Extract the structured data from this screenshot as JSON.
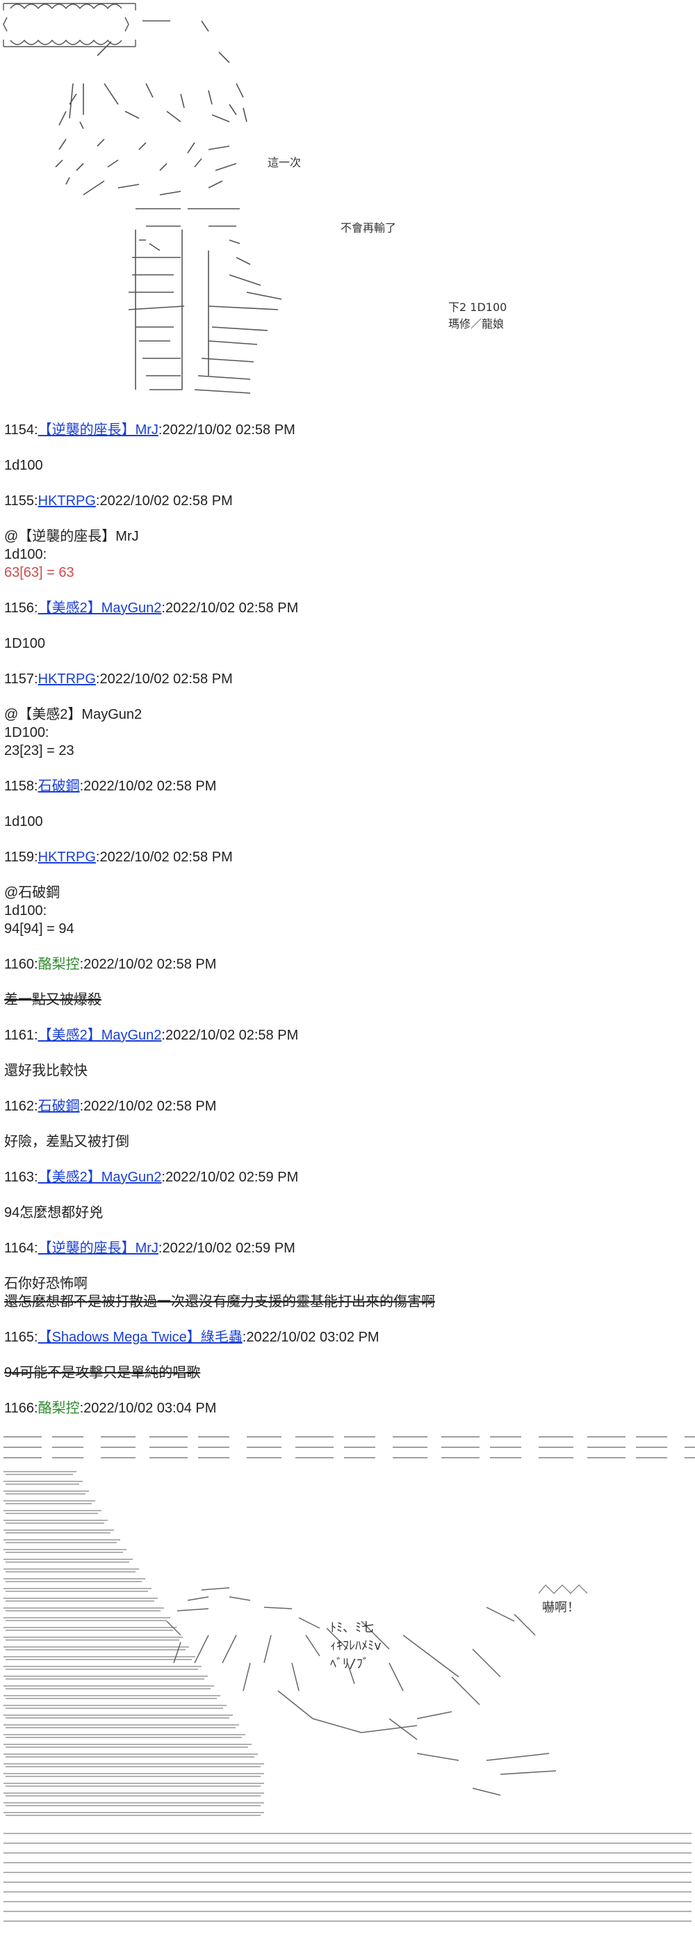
{
  "top_art": {
    "this_time": "這一次",
    "bubble_text": "不會再輸了",
    "roll_box_line1": "下2  1D100",
    "roll_box_line2": "瑪修／龍娘"
  },
  "posts": [
    {
      "num": "1154:",
      "name": "【逆襲的座長】MrJ",
      "name_style": "link",
      "time": ":2022/10/02 02:58 PM",
      "body": [
        "1d100"
      ]
    },
    {
      "num": "1155:",
      "name": "HKTRPG",
      "name_style": "link",
      "time": ":2022/10/02 02:58 PM",
      "body": [
        "@【逆襲的座長】MrJ",
        "1d100:"
      ],
      "result": "63[63] = 63",
      "result_red": true
    },
    {
      "num": "1156:",
      "name": "【美感2】MayGun2",
      "name_style": "link",
      "time": ":2022/10/02 02:58 PM",
      "body": [
        "1D100"
      ]
    },
    {
      "num": "1157:",
      "name": "HKTRPG",
      "name_style": "link",
      "time": ":2022/10/02 02:58 PM",
      "body": [
        "@【美感2】MayGun2",
        "1D100:"
      ],
      "result": "23[23] = 23",
      "result_red": false
    },
    {
      "num": "1158:",
      "name": "石破鋼",
      "name_style": "link",
      "time": ":2022/10/02 02:58 PM",
      "body": [
        "1d100"
      ]
    },
    {
      "num": "1159:",
      "name": "HKTRPG",
      "name_style": "link",
      "time": ":2022/10/02 02:58 PM",
      "body": [
        "@石破鋼",
        "1d100:"
      ],
      "result": "94[94] = 94",
      "result_red": false
    },
    {
      "num": "1160:",
      "name": "酪梨控",
      "name_style": "green",
      "time": ":2022/10/02 02:58 PM",
      "body_strike": "差一點又被爆殺"
    },
    {
      "num": "1161:",
      "name": "【美感2】MayGun2",
      "name_style": "link",
      "time": ":2022/10/02 02:58 PM",
      "body": [
        "還好我比較快"
      ]
    },
    {
      "num": "1162:",
      "name": "石破鋼",
      "name_style": "link",
      "time": ":2022/10/02 02:58 PM",
      "body": [
        "好險，差點又被打倒"
      ]
    },
    {
      "num": "1163:",
      "name": "【美感2】MayGun2",
      "name_style": "link",
      "time": ":2022/10/02 02:59 PM",
      "body": [
        "94怎麼想都好兇"
      ]
    },
    {
      "num": "1164:",
      "name": "【逆襲的座長】MrJ",
      "name_style": "link",
      "time": ":2022/10/02 02:59 PM",
      "body": [
        "石你好恐怖啊"
      ],
      "body_strike": "還怎麼想都不是被打散過一次還沒有魔力支援的靈基能打出來的傷害啊"
    },
    {
      "num": "1165:",
      "name": "【Shadows Mega Twice】綠毛蟲",
      "name_style": "link",
      "time": ":2022/10/02 03:02 PM",
      "body_strike": "94可能不是攻擊只是單純的唱歌"
    },
    {
      "num": "1166:",
      "name": "酪梨控",
      "name_style": "green",
      "time": ":2022/10/02 03:04 PM"
    }
  ],
  "bottom_art": {
    "shock": "嚇啊！",
    "sfx_line1": "ﾄﾐ、ﾐ七",
    "sfx_line2": "ｨｷﾌﾚﾊﾒﾐv",
    "sfx_line3": "ﾍﾞﾘ/ﾌﾞ"
  }
}
